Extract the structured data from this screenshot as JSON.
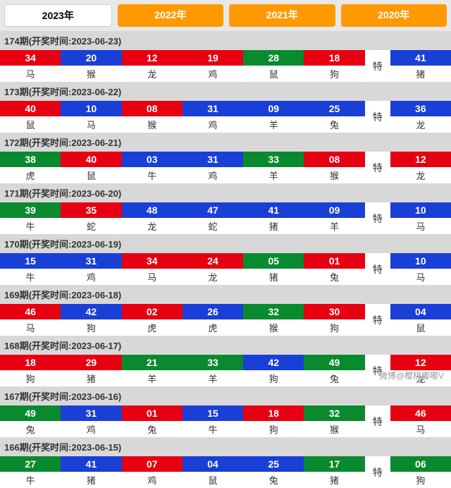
{
  "tabs": {
    "y2023": "2023年",
    "y2022": "2022年",
    "y2021": "2021年",
    "y2020": "2020年"
  },
  "te_label": "特",
  "watermark": "微博@樱桃嘟嘟V",
  "draws": [
    {
      "title": "174期(开奖时间:2023-06-23)",
      "balls": [
        {
          "n": "34",
          "z": "马",
          "c": "red"
        },
        {
          "n": "20",
          "z": "猴",
          "c": "blue"
        },
        {
          "n": "12",
          "z": "龙",
          "c": "red"
        },
        {
          "n": "19",
          "z": "鸡",
          "c": "red"
        },
        {
          "n": "28",
          "z": "鼠",
          "c": "green"
        },
        {
          "n": "18",
          "z": "狗",
          "c": "red"
        }
      ],
      "special": {
        "n": "41",
        "z": "猪",
        "c": "blue"
      }
    },
    {
      "title": "173期(开奖时间:2023-06-22)",
      "balls": [
        {
          "n": "40",
          "z": "鼠",
          "c": "red"
        },
        {
          "n": "10",
          "z": "马",
          "c": "blue"
        },
        {
          "n": "08",
          "z": "猴",
          "c": "red"
        },
        {
          "n": "31",
          "z": "鸡",
          "c": "blue"
        },
        {
          "n": "09",
          "z": "羊",
          "c": "blue"
        },
        {
          "n": "25",
          "z": "兔",
          "c": "blue"
        }
      ],
      "special": {
        "n": "36",
        "z": "龙",
        "c": "blue"
      }
    },
    {
      "title": "172期(开奖时间:2023-06-21)",
      "balls": [
        {
          "n": "38",
          "z": "虎",
          "c": "green"
        },
        {
          "n": "40",
          "z": "鼠",
          "c": "red"
        },
        {
          "n": "03",
          "z": "牛",
          "c": "blue"
        },
        {
          "n": "31",
          "z": "鸡",
          "c": "blue"
        },
        {
          "n": "33",
          "z": "羊",
          "c": "green"
        },
        {
          "n": "08",
          "z": "猴",
          "c": "red"
        }
      ],
      "special": {
        "n": "12",
        "z": "龙",
        "c": "red"
      }
    },
    {
      "title": "171期(开奖时间:2023-06-20)",
      "balls": [
        {
          "n": "39",
          "z": "牛",
          "c": "green"
        },
        {
          "n": "35",
          "z": "蛇",
          "c": "red"
        },
        {
          "n": "48",
          "z": "龙",
          "c": "blue"
        },
        {
          "n": "47",
          "z": "蛇",
          "c": "blue"
        },
        {
          "n": "41",
          "z": "猪",
          "c": "blue"
        },
        {
          "n": "09",
          "z": "羊",
          "c": "blue"
        }
      ],
      "special": {
        "n": "10",
        "z": "马",
        "c": "blue"
      }
    },
    {
      "title": "170期(开奖时间:2023-06-19)",
      "balls": [
        {
          "n": "15",
          "z": "牛",
          "c": "blue"
        },
        {
          "n": "31",
          "z": "鸡",
          "c": "blue"
        },
        {
          "n": "34",
          "z": "马",
          "c": "red"
        },
        {
          "n": "24",
          "z": "龙",
          "c": "red"
        },
        {
          "n": "05",
          "z": "猪",
          "c": "green"
        },
        {
          "n": "01",
          "z": "兔",
          "c": "red"
        }
      ],
      "special": {
        "n": "10",
        "z": "马",
        "c": "blue"
      }
    },
    {
      "title": "169期(开奖时间:2023-06-18)",
      "balls": [
        {
          "n": "46",
          "z": "马",
          "c": "red"
        },
        {
          "n": "42",
          "z": "狗",
          "c": "blue"
        },
        {
          "n": "02",
          "z": "虎",
          "c": "red"
        },
        {
          "n": "26",
          "z": "虎",
          "c": "blue"
        },
        {
          "n": "32",
          "z": "猴",
          "c": "green"
        },
        {
          "n": "30",
          "z": "狗",
          "c": "red"
        }
      ],
      "special": {
        "n": "04",
        "z": "鼠",
        "c": "blue"
      }
    },
    {
      "title": "168期(开奖时间:2023-06-17)",
      "balls": [
        {
          "n": "18",
          "z": "狗",
          "c": "red"
        },
        {
          "n": "29",
          "z": "猪",
          "c": "red"
        },
        {
          "n": "21",
          "z": "羊",
          "c": "green"
        },
        {
          "n": "33",
          "z": "羊",
          "c": "green"
        },
        {
          "n": "42",
          "z": "狗",
          "c": "blue"
        },
        {
          "n": "49",
          "z": "兔",
          "c": "green"
        }
      ],
      "special": {
        "n": "12",
        "z": "龙",
        "c": "red"
      }
    },
    {
      "title": "167期(开奖时间:2023-06-16)",
      "balls": [
        {
          "n": "49",
          "z": "兔",
          "c": "green"
        },
        {
          "n": "31",
          "z": "鸡",
          "c": "blue"
        },
        {
          "n": "01",
          "z": "兔",
          "c": "red"
        },
        {
          "n": "15",
          "z": "牛",
          "c": "blue"
        },
        {
          "n": "18",
          "z": "狗",
          "c": "red"
        },
        {
          "n": "32",
          "z": "猴",
          "c": "green"
        }
      ],
      "special": {
        "n": "46",
        "z": "马",
        "c": "red"
      }
    },
    {
      "title": "166期(开奖时间:2023-06-15)",
      "balls": [
        {
          "n": "27",
          "z": "牛",
          "c": "green"
        },
        {
          "n": "41",
          "z": "猪",
          "c": "blue"
        },
        {
          "n": "07",
          "z": "鸡",
          "c": "red"
        },
        {
          "n": "04",
          "z": "鼠",
          "c": "blue"
        },
        {
          "n": "25",
          "z": "兔",
          "c": "blue"
        },
        {
          "n": "17",
          "z": "猪",
          "c": "green"
        }
      ],
      "special": {
        "n": "06",
        "z": "狗",
        "c": "green"
      }
    }
  ]
}
